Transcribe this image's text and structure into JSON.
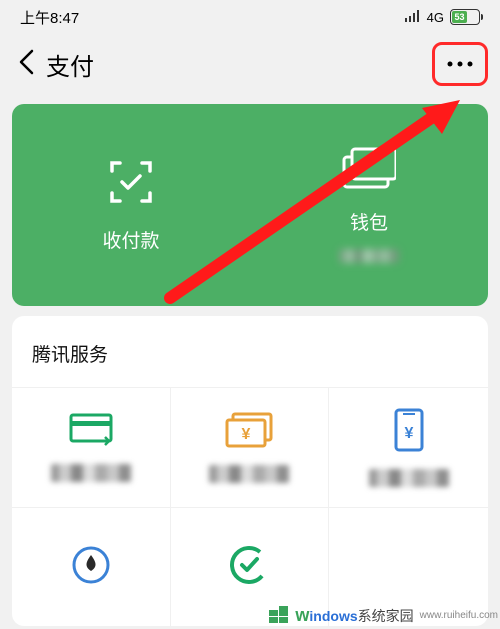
{
  "status": {
    "time": "上午8:47",
    "network": "4G",
    "battery_pct": "53"
  },
  "nav": {
    "title": "支付"
  },
  "green_card": {
    "pay_receive": "收付款",
    "wallet": "钱包"
  },
  "services": {
    "title": "腾讯服务"
  },
  "watermark": {
    "brand_prefix": "w",
    "brand_main": "indows",
    "brand_suffix": "系统家园",
    "url": "www.ruiheifu.com"
  },
  "icons": {
    "back": "back-chevron",
    "more": "more-horizontal",
    "scan_pay": "scan-check",
    "wallet": "wallet-cards",
    "card_transfer": "card-transfer",
    "yuan_ticket": "yuan-ticket",
    "phone_yuan": "phone-yuan",
    "water_drop": "water-drop",
    "shield_check": "shield-check"
  },
  "colors": {
    "accent_green": "#4caf65",
    "highlight_red": "#ff2a2a"
  }
}
